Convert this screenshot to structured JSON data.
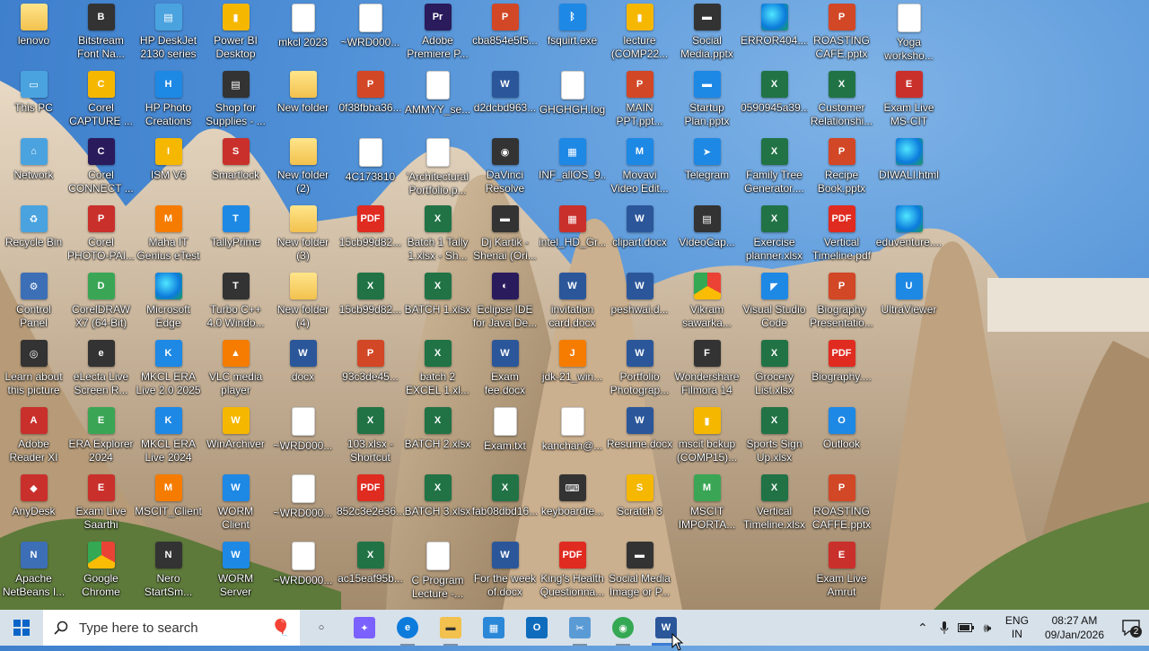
{
  "desktop": {
    "icons": [
      {
        "label": "lenovo",
        "type": "folder",
        "glyph": ""
      },
      {
        "label": "This PC",
        "type": "sys",
        "glyph": "▭"
      },
      {
        "label": "Network",
        "type": "sys",
        "glyph": "⌂"
      },
      {
        "label": "Recycle Bin",
        "type": "sys",
        "glyph": "♻"
      },
      {
        "label": "Control\nPanel",
        "type": "app",
        "glyph": "⚙"
      },
      {
        "label": "Learn about\nthis picture",
        "type": "dark",
        "glyph": "◎"
      },
      {
        "label": "Adobe\nReader XI",
        "type": "red",
        "glyph": "A"
      },
      {
        "label": "AnyDesk",
        "type": "red",
        "glyph": "◆"
      },
      {
        "label": "Apache\nNetBeans I...",
        "type": "app",
        "glyph": "N"
      },
      {
        "label": "Bitstream\nFont Na...",
        "type": "dark",
        "glyph": "B"
      },
      {
        "label": "Corel\nCAPTURE ...",
        "type": "yellow",
        "glyph": "C"
      },
      {
        "label": "Corel\nCONNECT ...",
        "type": "purple",
        "glyph": "C"
      },
      {
        "label": "Corel\nPHOTO-PAI...",
        "type": "red",
        "glyph": "P"
      },
      {
        "label": "CorelDRAW\nX7 (64-Bit)",
        "type": "green",
        "glyph": "D"
      },
      {
        "label": "eLecta Live\nScreen R...",
        "type": "dark",
        "glyph": "e"
      },
      {
        "label": "ERA Explorer\n2024",
        "type": "green",
        "glyph": "E"
      },
      {
        "label": "Exam Live\nSaarthi",
        "type": "red",
        "glyph": "E"
      },
      {
        "label": "Google\nChrome",
        "type": "chrome",
        "glyph": ""
      },
      {
        "label": "HP DeskJet\n2130 series",
        "type": "sys",
        "glyph": "▤"
      },
      {
        "label": "HP Photo\nCreations",
        "type": "blue",
        "glyph": "H"
      },
      {
        "label": "ISM V6",
        "type": "yellow",
        "glyph": "I"
      },
      {
        "label": "Maha IT\nGenius eTest",
        "type": "orange",
        "glyph": "M"
      },
      {
        "label": "Microsoft\nEdge",
        "type": "edge",
        "glyph": ""
      },
      {
        "label": "MKCL ERA\nLive 2.0 2025",
        "type": "blue",
        "glyph": "K"
      },
      {
        "label": "MKCL ERA\nLive 2024",
        "type": "blue",
        "glyph": "K"
      },
      {
        "label": "MSCIT_Client",
        "type": "orange",
        "glyph": "M"
      },
      {
        "label": "Nero\nStartSm...",
        "type": "dark",
        "glyph": "N"
      },
      {
        "label": "Power BI\nDesktop",
        "type": "yellow",
        "glyph": "▮"
      },
      {
        "label": "Shop for\nSupplies - ...",
        "type": "dark",
        "glyph": "▤"
      },
      {
        "label": "Smartlock",
        "type": "red",
        "glyph": "S"
      },
      {
        "label": "TallyPrime",
        "type": "blue",
        "glyph": "T"
      },
      {
        "label": "Turbo C++\n4.0 Windo...",
        "type": "dark",
        "glyph": "T"
      },
      {
        "label": "VLC media\nplayer",
        "type": "orange",
        "glyph": "▲"
      },
      {
        "label": "WinArchiver",
        "type": "yellow",
        "glyph": "W"
      },
      {
        "label": "WORM\nClient",
        "type": "blue",
        "glyph": "W"
      },
      {
        "label": "WORM\nServer",
        "type": "blue",
        "glyph": "W"
      },
      {
        "label": "mkcl 2023",
        "type": "doc",
        "glyph": ""
      },
      {
        "label": "New folder",
        "type": "folder",
        "glyph": ""
      },
      {
        "label": "New folder\n(2)",
        "type": "folder",
        "glyph": ""
      },
      {
        "label": "New folder\n(3)",
        "type": "folder",
        "glyph": ""
      },
      {
        "label": "New folder\n(4)",
        "type": "folder",
        "glyph": ""
      },
      {
        "label": "docx",
        "type": "word",
        "glyph": "W"
      },
      {
        "label": "~WRD000...",
        "type": "doc",
        "glyph": ""
      },
      {
        "label": "~WRD000...",
        "type": "doc",
        "glyph": ""
      },
      {
        "label": "~WRD000...",
        "type": "doc",
        "glyph": ""
      },
      {
        "label": "~WRD000...",
        "type": "doc",
        "glyph": ""
      },
      {
        "label": "0f38fbba36...",
        "type": "ppt",
        "glyph": "P"
      },
      {
        "label": "4C173810",
        "type": "doc",
        "glyph": ""
      },
      {
        "label": "15cb99d82...",
        "type": "pdf",
        "glyph": "PDF"
      },
      {
        "label": "15cb99d82...",
        "type": "excel",
        "glyph": "X"
      },
      {
        "label": "93c3de45...",
        "type": "ppt",
        "glyph": "P"
      },
      {
        "label": "103.xlsx -\nShortcut",
        "type": "excel",
        "glyph": "X"
      },
      {
        "label": "852c3e2e36...",
        "type": "pdf",
        "glyph": "PDF"
      },
      {
        "label": "ac15eaf95b...",
        "type": "excel",
        "glyph": "X"
      },
      {
        "label": "Adobe\nPremiere P...",
        "type": "purple",
        "glyph": "Pr"
      },
      {
        "label": "AMMYY_se...",
        "type": "doc",
        "glyph": ""
      },
      {
        "label": "'Architectural\nPortfolio.p...",
        "type": "doc",
        "glyph": ""
      },
      {
        "label": "Batch 1 Tally\n1.xlsx - Sh...",
        "type": "excel",
        "glyph": "X"
      },
      {
        "label": "BATCH 1.xlsx",
        "type": "excel",
        "glyph": "X"
      },
      {
        "label": "batch 2\nEXCEL 1.xl...",
        "type": "excel",
        "glyph": "X"
      },
      {
        "label": "BATCH 2.xlsx",
        "type": "excel",
        "glyph": "X"
      },
      {
        "label": "BATCH 3.xlsx",
        "type": "excel",
        "glyph": "X"
      },
      {
        "label": "C Program\nLecture -...",
        "type": "doc",
        "glyph": ""
      },
      {
        "label": "cba854e5f5...",
        "type": "ppt",
        "glyph": "P"
      },
      {
        "label": "d2dcbd963...",
        "type": "word",
        "glyph": "W"
      },
      {
        "label": "DaVinci\nResolve",
        "type": "dark",
        "glyph": "◉"
      },
      {
        "label": "Dj Kartik -\nShenai (Ori...",
        "type": "dark",
        "glyph": "▬"
      },
      {
        "label": "Eclipse IDE\nfor Java De...",
        "type": "purple",
        "glyph": "◐"
      },
      {
        "label": "Exam\nfee.docx",
        "type": "word",
        "glyph": "W"
      },
      {
        "label": "Exam.txt",
        "type": "doc",
        "glyph": ""
      },
      {
        "label": "fab08dbd16...",
        "type": "excel",
        "glyph": "X"
      },
      {
        "label": "For the week\nof.docx",
        "type": "word",
        "glyph": "W"
      },
      {
        "label": "fsquirt.exe",
        "type": "blue",
        "glyph": "ᛒ"
      },
      {
        "label": "GHGHGH.log",
        "type": "doc",
        "glyph": ""
      },
      {
        "label": "INF_allOS_9...",
        "type": "blue",
        "glyph": "▦"
      },
      {
        "label": "intel_HD_Gr...",
        "type": "red",
        "glyph": "▦"
      },
      {
        "label": "invitation\ncard.docx",
        "type": "word",
        "glyph": "W"
      },
      {
        "label": "jdk-21_win...",
        "type": "orange",
        "glyph": "J"
      },
      {
        "label": "kanchan@...",
        "type": "doc",
        "glyph": ""
      },
      {
        "label": "keyboardte...",
        "type": "dark",
        "glyph": "⌨"
      },
      {
        "label": "King's Health\nQuestionna...",
        "type": "pdf",
        "glyph": "PDF"
      },
      {
        "label": "lecture\n(COMP22...",
        "type": "yellow",
        "glyph": "▮"
      },
      {
        "label": "MAIN\nPPT.ppt...",
        "type": "ppt",
        "glyph": "P"
      },
      {
        "label": "Movavi\nVideo Edit...",
        "type": "blue",
        "glyph": "M"
      },
      {
        "label": "clipart.docx",
        "type": "word",
        "glyph": "W"
      },
      {
        "label": "peshwai.d...",
        "type": "word",
        "glyph": "W"
      },
      {
        "label": "Portfolio\nPhotograp...",
        "type": "word",
        "glyph": "W"
      },
      {
        "label": "Resume.docx",
        "type": "word",
        "glyph": "W"
      },
      {
        "label": "Scratch 3",
        "type": "yellow",
        "glyph": "S"
      },
      {
        "label": "Social Media\nImage or P...",
        "type": "dark",
        "glyph": "▬"
      },
      {
        "label": "Social\nMedia.pptx",
        "type": "dark",
        "glyph": "▬"
      },
      {
        "label": "Startup\nPlan.pptx",
        "type": "blue",
        "glyph": "▬"
      },
      {
        "label": "Telegram",
        "type": "blue",
        "glyph": "➤"
      },
      {
        "label": "VideoCap...",
        "type": "dark",
        "glyph": "▤"
      },
      {
        "label": "Vikram\nsawarka...",
        "type": "chrome",
        "glyph": ""
      },
      {
        "label": "Wondershare\nFilmora 14",
        "type": "dark",
        "glyph": "F"
      },
      {
        "label": "mscit bckup\n(COMP15)...",
        "type": "yellow",
        "glyph": "▮"
      },
      {
        "label": "MSCIT\nIMPORTA...",
        "type": "green",
        "glyph": "M"
      },
      {
        "label": "ERROR404....",
        "type": "edge",
        "glyph": ""
      },
      {
        "label": "0590945a39...",
        "type": "excel",
        "glyph": "X"
      },
      {
        "label": "Family Tree\nGenerator....",
        "type": "excel",
        "glyph": "X"
      },
      {
        "label": "Exercise\nplanner.xlsx",
        "type": "excel",
        "glyph": "X"
      },
      {
        "label": "Visual Studio\nCode",
        "type": "blue",
        "glyph": "◤"
      },
      {
        "label": "Grocery\nList.xlsx",
        "type": "excel",
        "glyph": "X"
      },
      {
        "label": "Sports Sign\nUp.xlsx",
        "type": "excel",
        "glyph": "X"
      },
      {
        "label": "Vertical\nTimeline.xlsx",
        "type": "excel",
        "glyph": "X"
      },
      {
        "label": "ROASTING\nCAFE.pptx",
        "type": "ppt",
        "glyph": "P"
      },
      {
        "label": "Customer\nRelationshi...",
        "type": "excel",
        "glyph": "X"
      },
      {
        "label": "Recipe\nBook.pptx",
        "type": "ppt",
        "glyph": "P"
      },
      {
        "label": "Vertical\nTimeline.pdf",
        "type": "pdf",
        "glyph": "PDF"
      },
      {
        "label": "Biography\nPresentatio...",
        "type": "ppt",
        "glyph": "P"
      },
      {
        "label": "Biography....",
        "type": "pdf",
        "glyph": "PDF"
      },
      {
        "label": "Outlook",
        "type": "blue",
        "glyph": "O"
      },
      {
        "label": "ROASTING\nCAFFE.pptx",
        "type": "ppt",
        "glyph": "P"
      },
      {
        "label": "Exam Live\nAmrut",
        "type": "red",
        "glyph": "E"
      },
      {
        "label": "Yoga\nworksho...",
        "type": "doc",
        "glyph": ""
      },
      {
        "label": "Exam Live\nMS-CIT",
        "type": "red",
        "glyph": "E"
      },
      {
        "label": "DIWALI.html",
        "type": "edge",
        "glyph": ""
      },
      {
        "label": "eduventure....",
        "type": "edge",
        "glyph": ""
      },
      {
        "label": "UltraViewer",
        "type": "blue",
        "glyph": "U"
      }
    ]
  },
  "taskbar": {
    "search_placeholder": "Type here to search",
    "apps": [
      {
        "name": "task-view",
        "glyph": "○",
        "color": "#d7e1ea",
        "text": "#222"
      },
      {
        "name": "copilot",
        "glyph": "✦",
        "color": "#7b61ff",
        "text": "#fff"
      },
      {
        "name": "edge",
        "glyph": "e",
        "color": "#0c7bdc",
        "text": "#fff"
      },
      {
        "name": "file-explorer",
        "glyph": "▬",
        "color": "#f2c14e",
        "text": "#333"
      },
      {
        "name": "microsoft-store",
        "glyph": "▦",
        "color": "#2b88d8",
        "text": "#fff"
      },
      {
        "name": "outlook",
        "glyph": "O",
        "color": "#0f6cbd",
        "text": "#fff"
      },
      {
        "name": "snipping-tool",
        "glyph": "✂",
        "color": "#5a9bd5",
        "text": "#fff"
      },
      {
        "name": "chrome",
        "glyph": "◉",
        "color": "#34a853",
        "text": "#fff"
      },
      {
        "name": "word",
        "glyph": "W",
        "color": "#2b579a",
        "text": "#fff"
      }
    ],
    "language_line1": "ENG",
    "language_line2": "IN",
    "time": "08:27 AM",
    "date": "09/Jan/2026",
    "notification_count": "2"
  },
  "colors": {
    "taskbar_bg": "#d7e1ea",
    "accent": "#3b7bd4"
  }
}
